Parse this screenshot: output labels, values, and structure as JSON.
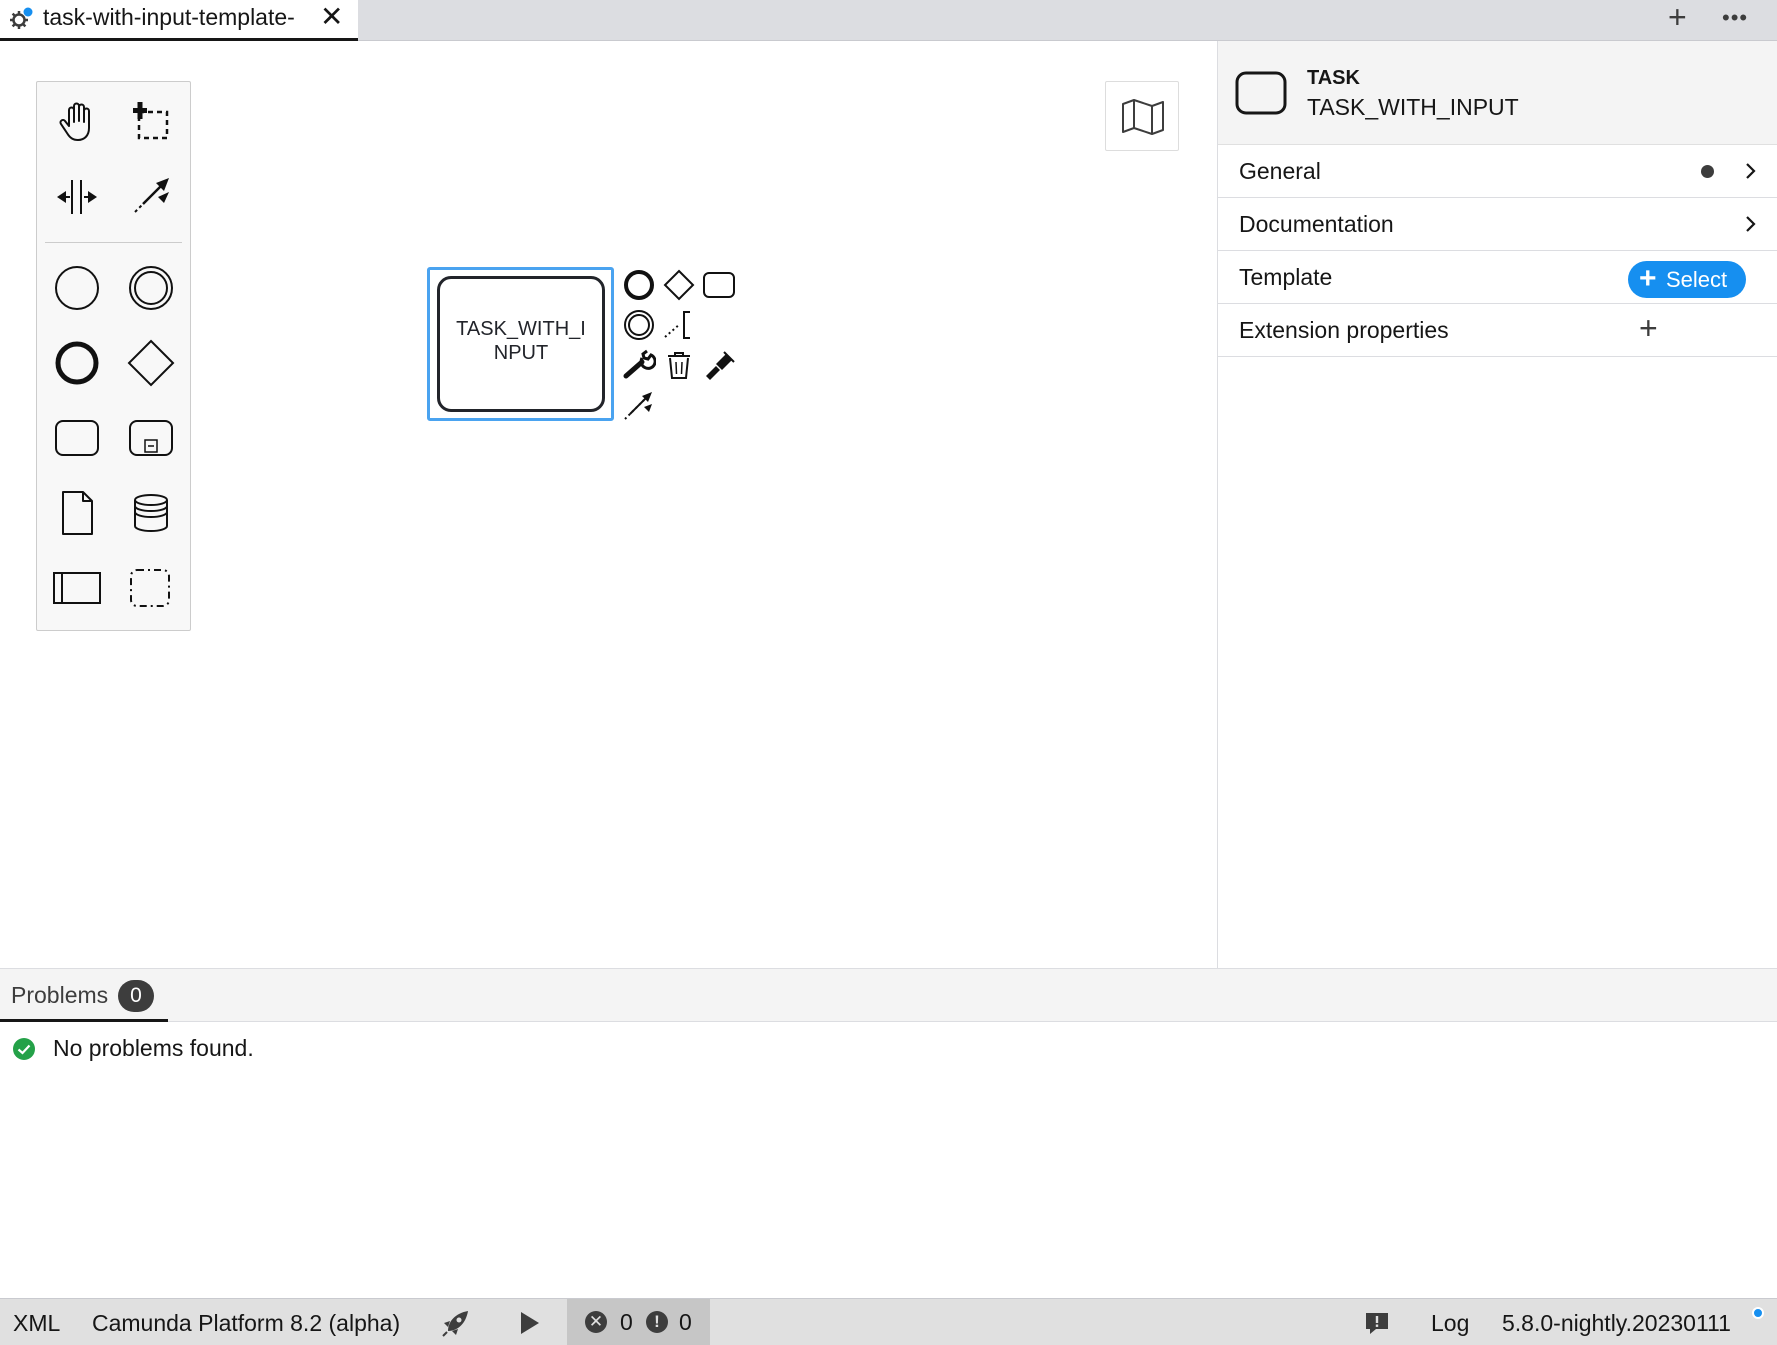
{
  "tabbar": {
    "tab_title": "task-with-input-template-",
    "close_glyph": "✕",
    "new_tab_glyph": "+",
    "more_glyph": "•••",
    "tab_icon": "gear-icon"
  },
  "canvas": {
    "palette_tools": [
      "hand-tool-icon",
      "lasso-tool-icon",
      "space-tool-icon",
      "global-connect-tool-icon"
    ],
    "palette_shapes": [
      "start-event-icon",
      "intermediate-event-icon",
      "end-event-icon",
      "gateway-icon",
      "task-icon",
      "subprocess-icon",
      "data-object-icon",
      "data-store-icon",
      "pool-icon",
      "group-icon"
    ],
    "minimap_icon": "map-icon",
    "task": {
      "label_line1": "TASK_WITH_I",
      "label_line2": "NPUT",
      "selection_color": "#4aa3f0"
    },
    "context_pad": [
      "append-end-event-icon",
      "append-gateway-icon",
      "append-task-icon",
      "append-intermediate-event-icon",
      "text-annotation-icon",
      "wrench-icon",
      "trash-icon",
      "paint-brush-icon",
      "connect-icon"
    ]
  },
  "properties": {
    "element_type": "TASK",
    "element_name": "TASK_WITH_INPUT",
    "groups": {
      "general": "General",
      "documentation": "Documentation",
      "template": "Template",
      "extension": "Extension properties"
    },
    "select_label": "Select",
    "select_plus": "+",
    "extension_plus": "+",
    "accent": "#168ff0"
  },
  "problems": {
    "tab_label": "Problems",
    "count": "0",
    "message": "No problems found.",
    "ok_color": "#24a148"
  },
  "statusbar": {
    "xml": "XML",
    "platform": "Camunda Platform 8.2 (alpha)",
    "errors": "0",
    "warnings": "0",
    "error_glyph": "✕",
    "warning_glyph": "!",
    "log": "Log",
    "version": "5.8.0-nightly.20230111"
  }
}
